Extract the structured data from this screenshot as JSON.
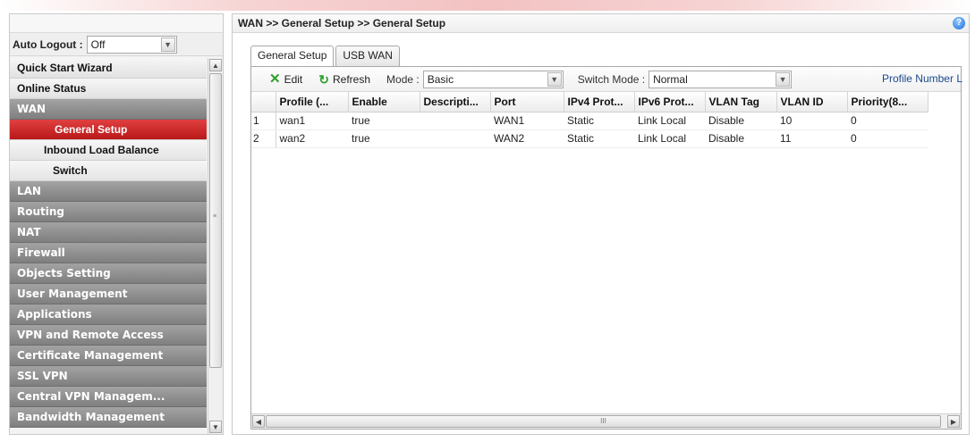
{
  "sidebar": {
    "autologout_label": "Auto Logout :",
    "autologout_value": "Off",
    "items": [
      {
        "label": "Quick Start Wizard",
        "style": "light"
      },
      {
        "label": "Online Status",
        "style": "light"
      },
      {
        "label": "WAN",
        "style": "dark"
      },
      {
        "label": "General Setup",
        "style": "active"
      },
      {
        "label": "Inbound Load Balance",
        "style": "sub"
      },
      {
        "label": "Switch",
        "style": "plain"
      },
      {
        "label": "LAN",
        "style": "dark"
      },
      {
        "label": "Routing",
        "style": "dark"
      },
      {
        "label": "NAT",
        "style": "dark"
      },
      {
        "label": "Firewall",
        "style": "dark"
      },
      {
        "label": "Objects Setting",
        "style": "dark"
      },
      {
        "label": "User Management",
        "style": "dark"
      },
      {
        "label": "Applications",
        "style": "dark"
      },
      {
        "label": "VPN and Remote Access",
        "style": "dark"
      },
      {
        "label": "Certificate Management",
        "style": "dark"
      },
      {
        "label": "SSL VPN",
        "style": "dark"
      },
      {
        "label": "Central VPN Managem...",
        "style": "dark"
      },
      {
        "label": "Bandwidth Management",
        "style": "dark"
      }
    ]
  },
  "header": {
    "breadcrumb": "WAN >> General Setup >> General Setup",
    "help_icon": "?"
  },
  "tabs": [
    {
      "label": "General Setup",
      "active": true
    },
    {
      "label": "USB WAN",
      "active": false
    }
  ],
  "toolbar": {
    "edit_label": "Edit",
    "refresh_label": "Refresh",
    "mode_label": "Mode :",
    "mode_value": "Basic",
    "switch_mode_label": "Switch Mode :",
    "switch_mode_value": "Normal",
    "profile_number_label": "Profile Number L"
  },
  "table": {
    "columns": [
      "",
      "Profile (...",
      "Enable",
      "Descripti...",
      "Port",
      "IPv4 Prot...",
      "IPv6 Prot...",
      "VLAN Tag",
      "VLAN ID",
      "Priority(8..."
    ],
    "rows": [
      [
        "1",
        "wan1",
        "true",
        "",
        "WAN1",
        "Static",
        "Link Local",
        "Disable",
        "10",
        "0"
      ],
      [
        "2",
        "wan2",
        "true",
        "",
        "WAN2",
        "Static",
        "Link Local",
        "Disable",
        "11",
        "0"
      ]
    ]
  },
  "scroll_glyph": "III",
  "icons": {
    "edit": "edit-x-icon",
    "refresh": "refresh-icon",
    "help": "help-icon"
  },
  "colors": {
    "active_menu": "#c82020",
    "dark_menu": "#8f8f8f",
    "profile_link": "#1a4a8a"
  }
}
